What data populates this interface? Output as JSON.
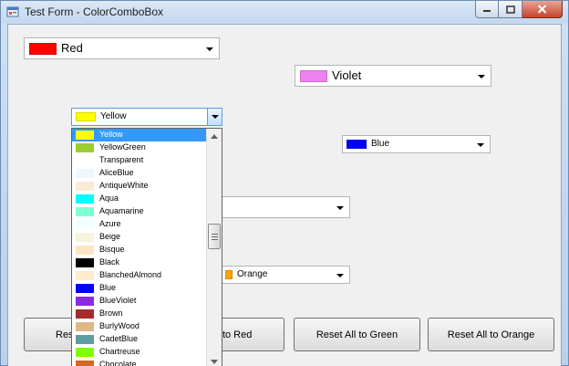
{
  "window": {
    "title": "Test Form - ColorComboBox"
  },
  "combos": [
    {
      "id": "red",
      "label": "Red",
      "color": "#ff0000"
    },
    {
      "id": "violet",
      "label": "Violet",
      "color": "#ee82ee"
    },
    {
      "id": "yellow",
      "label": "Yellow",
      "color": "#ffff00"
    },
    {
      "id": "blue",
      "label": "Blue",
      "color": "#0000ff"
    },
    {
      "id": "empty",
      "label": "",
      "color": ""
    },
    {
      "id": "orange",
      "label": "Orange",
      "color": "#ffa500"
    }
  ],
  "buttons": {
    "reset_all_red": "Reset All to Red",
    "reset_all_red_partial_left": "Res",
    "reset_all_red_partial_right": "ll to Red",
    "reset_all_green": "Reset All to Green",
    "reset_all_orange": "Reset All to Orange"
  },
  "dropdown": {
    "items": [
      {
        "label": "Yellow",
        "color": "#ffff00",
        "selected": true
      },
      {
        "label": "YellowGreen",
        "color": "#9acd32"
      },
      {
        "label": "Transparent",
        "color": "#ffffff"
      },
      {
        "label": "AliceBlue",
        "color": "#f0f8ff"
      },
      {
        "label": "AntiqueWhite",
        "color": "#faebd7"
      },
      {
        "label": "Aqua",
        "color": "#00ffff"
      },
      {
        "label": "Aquamarine",
        "color": "#7fffd4"
      },
      {
        "label": "Azure",
        "color": "#f0ffff"
      },
      {
        "label": "Beige",
        "color": "#f5f5dc"
      },
      {
        "label": "Bisque",
        "color": "#ffe4c4"
      },
      {
        "label": "Black",
        "color": "#000000"
      },
      {
        "label": "BlanchedAlmond",
        "color": "#ffebcd"
      },
      {
        "label": "Blue",
        "color": "#0000ff"
      },
      {
        "label": "BlueViolet",
        "color": "#8a2be2"
      },
      {
        "label": "Brown",
        "color": "#a52a2a"
      },
      {
        "label": "BurlyWood",
        "color": "#deb887"
      },
      {
        "label": "CadetBlue",
        "color": "#5f9ea0"
      },
      {
        "label": "Chartreuse",
        "color": "#7fff00"
      },
      {
        "label": "Chocolate",
        "color": "#d2691e"
      }
    ]
  }
}
